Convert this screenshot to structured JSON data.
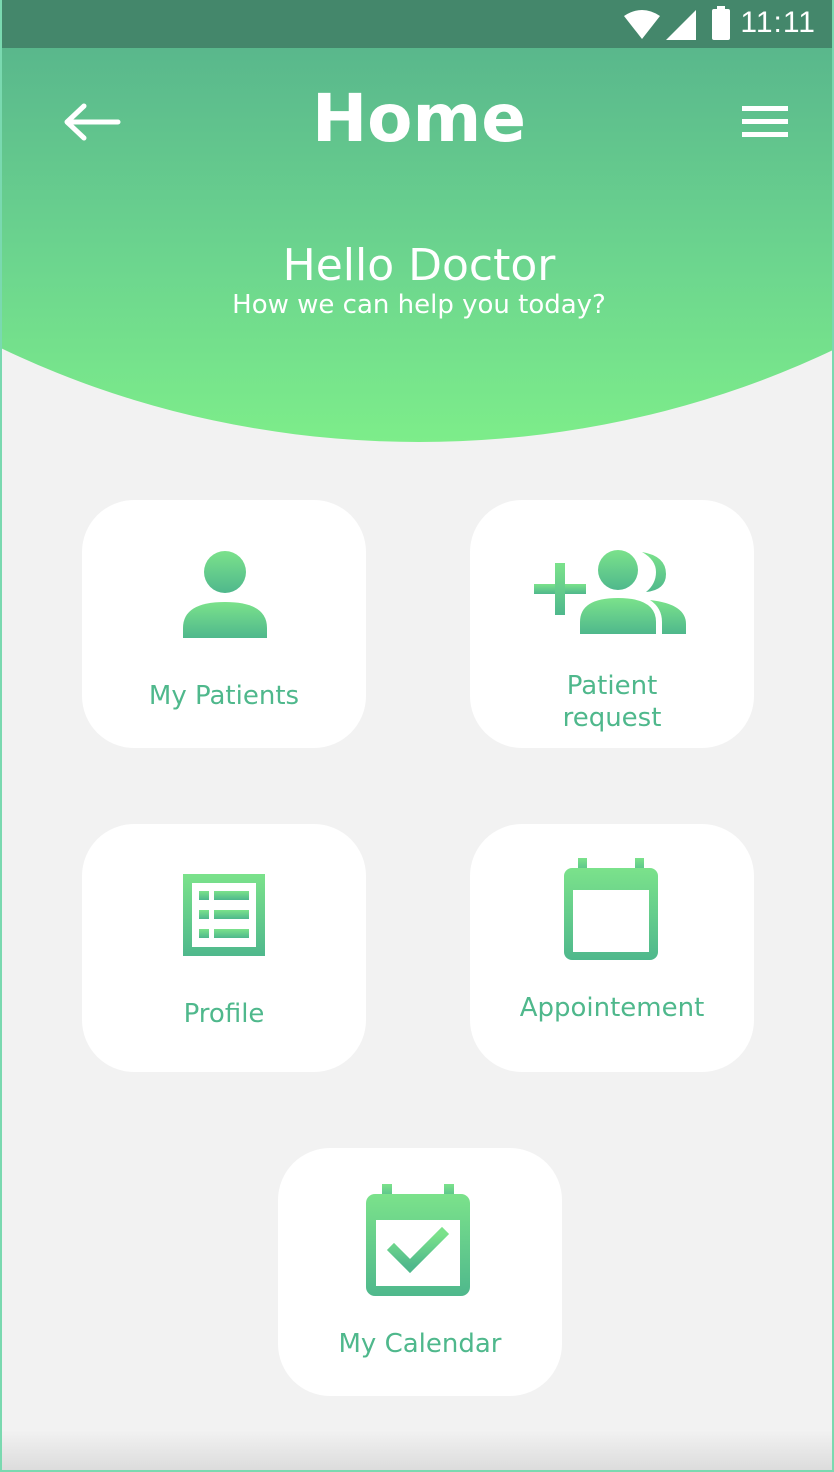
{
  "status_bar": {
    "time": "11:11",
    "icons": [
      "wifi-icon",
      "signal-icon",
      "battery-icon"
    ]
  },
  "nav": {
    "title": "Home",
    "back_icon": "arrow-left-icon",
    "menu_icon": "hamburger-menu-icon"
  },
  "greeting": {
    "title": "Hello Doctor",
    "subtitle": "How we can help you today?"
  },
  "cards": [
    {
      "label": "My Patients",
      "icon": "person-icon"
    },
    {
      "label": "Patient\nrequest",
      "icon": "group-add-icon"
    },
    {
      "label": "Profile",
      "icon": "list-document-icon"
    },
    {
      "label": "Appointement",
      "icon": "calendar-icon"
    },
    {
      "label": "My Calendar",
      "icon": "calendar-check-icon"
    }
  ],
  "colors": {
    "header_top": "#44876b",
    "header_bottom": "#7ded8a",
    "accent": "#4fb88c",
    "icon_light": "#7be28b",
    "icon_dark": "#4fb88c",
    "background": "#f2f2f2",
    "card": "#ffffff"
  }
}
